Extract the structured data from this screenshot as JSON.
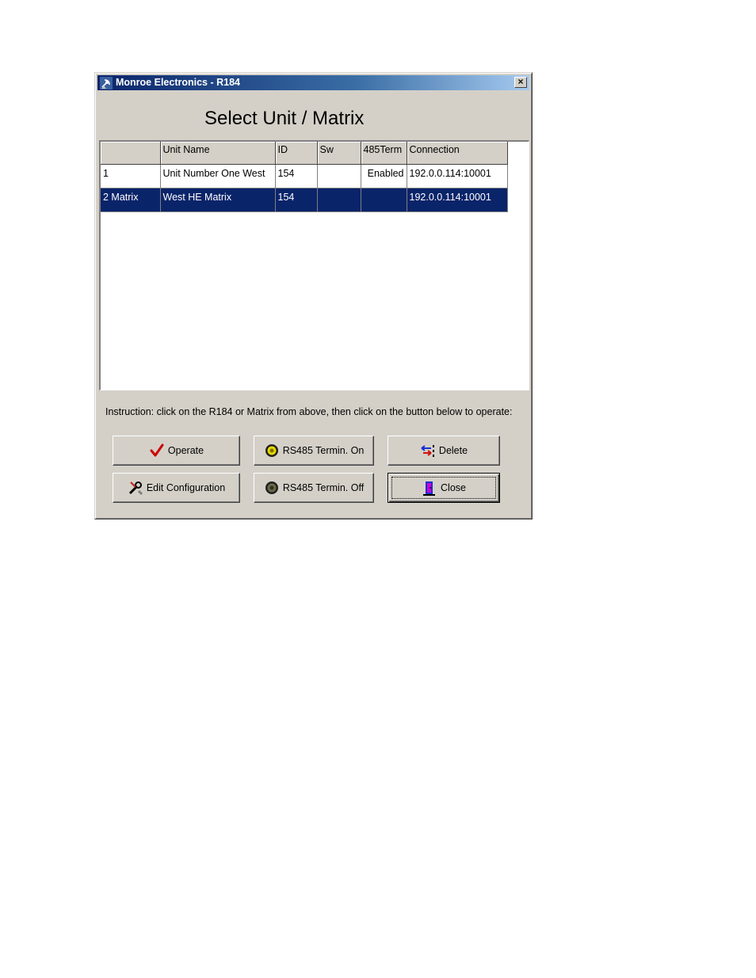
{
  "window": {
    "title": "Monroe Electronics - R184",
    "close_glyph": "×"
  },
  "heading": "Select Unit / Matrix",
  "table": {
    "columns": [
      "",
      "Unit Name",
      "ID",
      "Sw",
      "485Term",
      "Connection"
    ],
    "rows": [
      [
        "1",
        "Unit Number One West",
        "154",
        "",
        "Enabled",
        "192.0.0.114:10001"
      ],
      [
        "2 Matrix",
        "West HE Matrix",
        "154",
        "",
        "",
        "192.0.0.114:10001"
      ]
    ],
    "selected_row": 1
  },
  "instruction": "Instruction: click on the R184 or Matrix from above, then click on the button below to operate:",
  "buttons": {
    "operate": "Operate",
    "rs485_on": "RS485 Termin. On",
    "delete": "Delete",
    "edit_configuration": "Edit Configuration",
    "rs485_off": "RS485 Termin. Off",
    "close": "Close"
  },
  "icons": {
    "operate": "check-icon",
    "rs485_on": "led-on-icon",
    "delete": "delete-arrows-icon",
    "edit_configuration": "tools-icon",
    "rs485_off": "led-off-icon",
    "close": "door-icon",
    "app": "satellite-icon"
  },
  "colors": {
    "selection": "#0a246a",
    "check": "#cc0000",
    "led_on": "#e6d800"
  }
}
